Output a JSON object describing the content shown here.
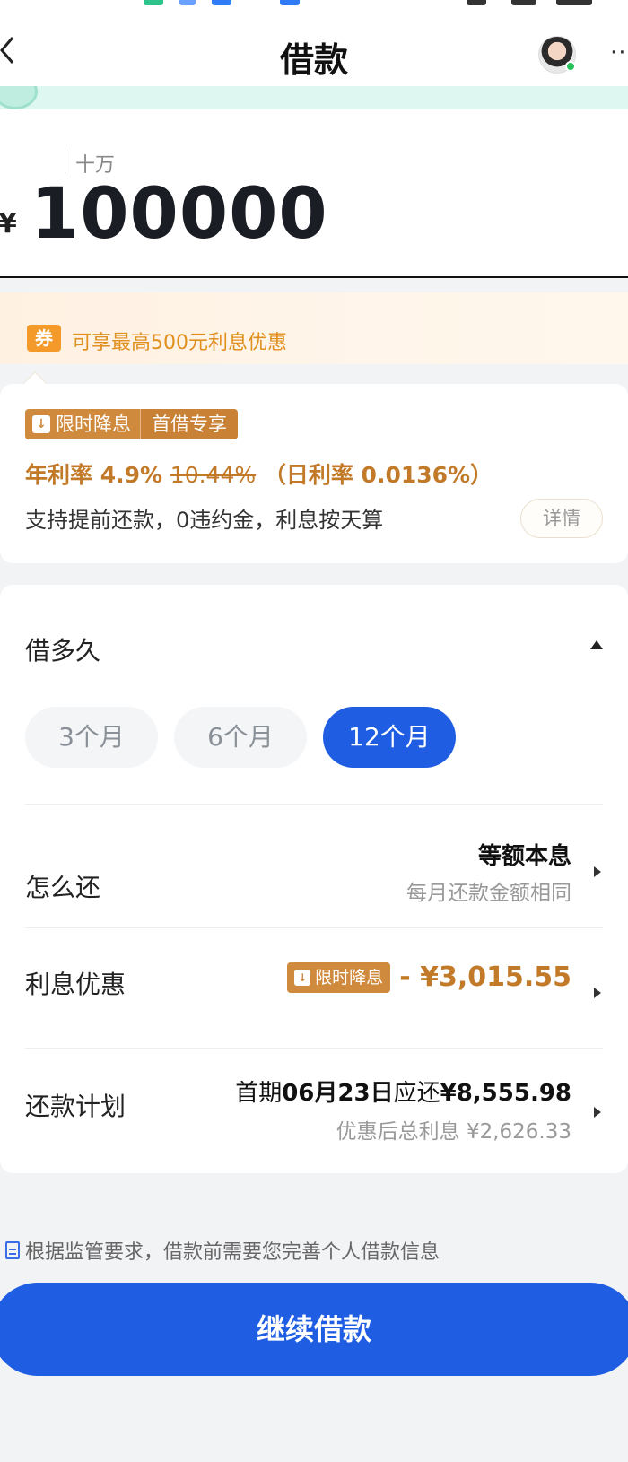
{
  "header": {
    "title": "借款",
    "back_icon": "chevron-left-icon",
    "more_label": "···"
  },
  "amount": {
    "hint": "十万",
    "currency": "¥",
    "value": "100000"
  },
  "coupon": {
    "badge": "券",
    "text": "可享最高500元利息优惠"
  },
  "rate": {
    "tag_limited": "限时降息",
    "tag_first": "首借专享",
    "label": "年利率",
    "current": "4.9%",
    "original": "10.44%",
    "daily": "（日利率 0.0136%）",
    "desc": "支持提前还款，0违约金，利息按天算",
    "detail_button": "详情"
  },
  "term": {
    "label": "借多久",
    "options": [
      "3个月",
      "6个月",
      "12个月"
    ],
    "selected": "12个月"
  },
  "repay_method": {
    "label": "怎么还",
    "value": "等额本息",
    "sub": "每月还款金额相同"
  },
  "interest_discount": {
    "label": "利息优惠",
    "tag": "限时降息",
    "amount": "- ¥3,015.55"
  },
  "plan": {
    "label": "还款计划",
    "first_prefix": "首期",
    "first_date": "06月23日",
    "first_mid": "应还",
    "first_amount": "¥8,555.98",
    "total_interest_label": "优惠后总利息",
    "total_interest": "¥2,626.33"
  },
  "footer": {
    "note": "根据监管要求，借款前需要您完善个人借款信息",
    "continue_button": "继续借款"
  },
  "colors": {
    "primary": "#1f5de3",
    "accent_orange": "#c27a28",
    "coupon_orange": "#f39a2a"
  }
}
